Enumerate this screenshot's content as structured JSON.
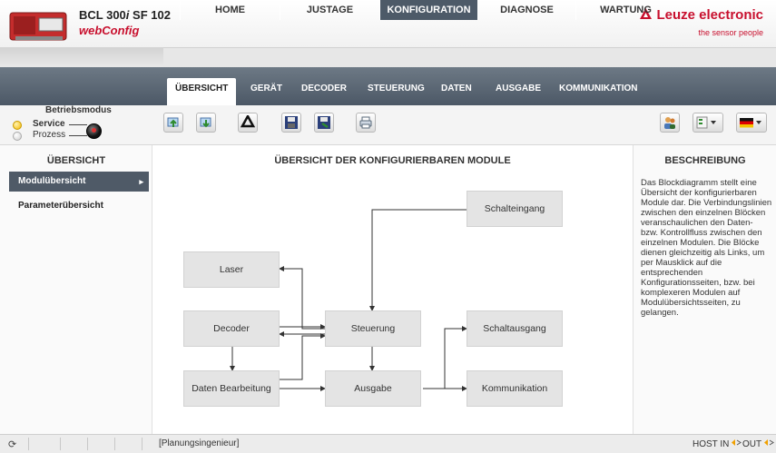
{
  "header": {
    "product_name_prefix": "BCL 300",
    "product_name_italic": "i",
    "product_name_suffix": " SF 102",
    "app_name": "webConfig",
    "brand": "Leuze electronic",
    "tagline": "the sensor people"
  },
  "main_tabs": [
    "HOME",
    "JUSTAGE",
    "KONFIGURATION",
    "DIAGNOSE",
    "WARTUNG"
  ],
  "sub_tabs": [
    "ÜBERSICHT",
    "GERÄT",
    "DECODER",
    "STEUERUNG",
    "DATEN",
    "AUSGABE",
    "KOMMUNIKATION"
  ],
  "mode": {
    "title": "Betriebsmodus",
    "service": "Service",
    "process": "Prozess"
  },
  "left_panel": {
    "title": "ÜBERSICHT",
    "items": [
      "Modulübersicht",
      "Parameterübersicht"
    ]
  },
  "center": {
    "title": "ÜBERSICHT DER KONFIGURIERBAREN MODULE",
    "modules": {
      "schalteingang": "Schalteingang",
      "laser": "Laser",
      "decoder": "Decoder",
      "steuerung": "Steuerung",
      "schaltausgang": "Schaltausgang",
      "daten_bearbeitung": "Daten Bearbeitung",
      "ausgabe": "Ausgabe",
      "kommunikation": "Kommunikation"
    }
  },
  "right_panel": {
    "title": "BESCHREIBUNG",
    "description": "Das Blockdiagramm stellt eine Übersicht der konfigurierbaren Module dar. Die Verbindungslinien zwischen den einzelnen Blöcken veranschaulichen den Daten- bzw. Kontrollfluss zwischen den einzelnen Modulen. Die Blöcke dienen gleichzeitig als Links, um per Mausklick auf die entsprechenden Konfigurationsseiten, bzw. bei komplexeren Modulen auf Modulübersichtsseiten, zu gelangen."
  },
  "status_bar": {
    "role": "[Planungsingenieur]",
    "host_in": "HOST IN",
    "out": "OUT"
  },
  "colors": {
    "brand_red": "#c8102e",
    "nav_dark": "#4d5a68",
    "module_bg": "#e4e4e4"
  },
  "icons": [
    "device-image",
    "leuze-logo-icon",
    "upload-icon",
    "download-icon",
    "recycle-icon",
    "save-icon",
    "load-icon",
    "print-icon",
    "users-icon",
    "menu-icon",
    "flag-de-icon",
    "refresh-icon",
    "host-signal-icon",
    "out-signal-icon"
  ]
}
